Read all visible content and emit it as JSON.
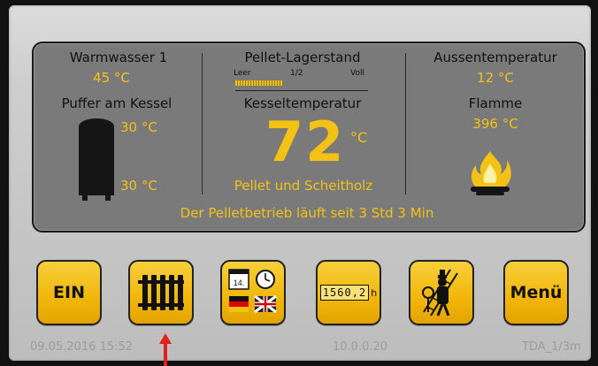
{
  "panel": {
    "warmwasser_label": "Warmwasser 1",
    "warmwasser_value": "45 °C",
    "puffer_label": "Puffer am Kessel",
    "puffer_top_value": "30 °C",
    "puffer_bottom_value": "30 °C",
    "pellet_lager_label": "Pellet-Lagerstand",
    "pellet_scale_leer": "Leer",
    "pellet_scale_half": "1/2",
    "pellet_scale_voll": "Voll",
    "pellet_level_fraction": 0.36,
    "kessel_label": "Kesseltemperatur",
    "kessel_value": "72",
    "kessel_unit": "°C",
    "mode_text": "Pellet und Scheitholz",
    "aussen_label": "Aussentemperatur",
    "aussen_value": "12 °C",
    "flamme_label": "Flamme",
    "flamme_value": "396 °C",
    "status_text": "Der Pelletbetrieb läuft seit 3 Std 3 Min"
  },
  "buttons": {
    "ein_label": "EIN",
    "calendar_day": "14.",
    "hours_text": "1560,2",
    "hours_unit": "h",
    "menu_label": "Menü"
  },
  "footer": {
    "datetime": "09.05.2016 15:52",
    "ip": "10.0.0.20",
    "device": "TDA_1/3m"
  },
  "colors": {
    "accent_yellow": "#f4c215",
    "panel_gray": "#7a7a7a",
    "arrow_red": "#e0201b"
  },
  "icons": [
    "radiator-icon",
    "calendar-icon",
    "clock-icon",
    "flag-icon",
    "hour-counter-icon",
    "chimney-sweep-icon",
    "flame-icon",
    "buffer-tank-icon",
    "pointer-arrow-icon"
  ]
}
